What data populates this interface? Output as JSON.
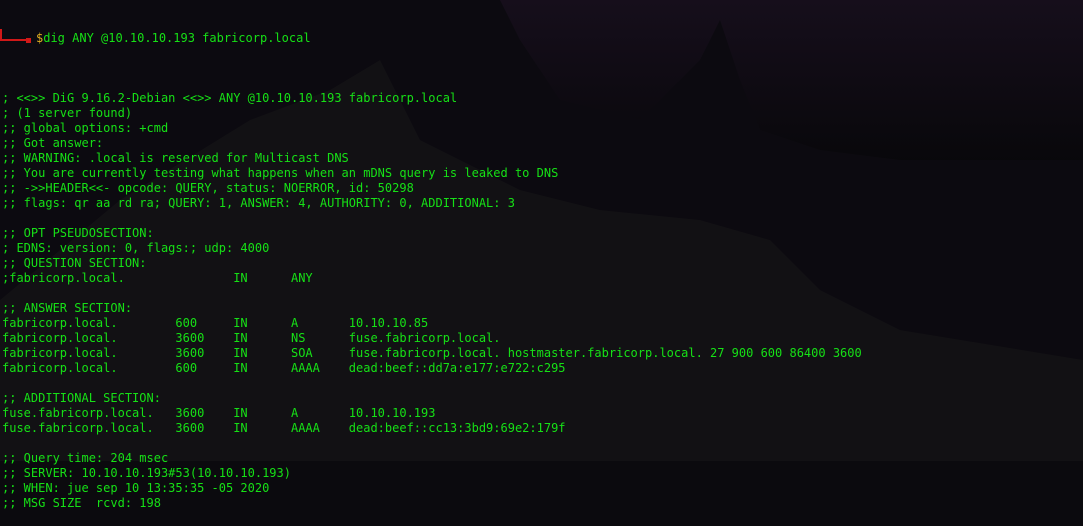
{
  "prompt": {
    "symbol": "$",
    "command": "dig ANY @10.10.10.193 fabricorp.local"
  },
  "colors": {
    "text": "#16e016",
    "prompt_symbol": "#e0b020",
    "prompt_border": "#d01818",
    "background": "#0b0a0e"
  },
  "output_lines": [
    "",
    "; <<>> DiG 9.16.2-Debian <<>> ANY @10.10.10.193 fabricorp.local",
    "; (1 server found)",
    ";; global options: +cmd",
    ";; Got answer:",
    ";; WARNING: .local is reserved for Multicast DNS",
    ";; You are currently testing what happens when an mDNS query is leaked to DNS",
    ";; ->>HEADER<<- opcode: QUERY, status: NOERROR, id: 50298",
    ";; flags: qr aa rd ra; QUERY: 1, ANSWER: 4, AUTHORITY: 0, ADDITIONAL: 3",
    "",
    ";; OPT PSEUDOSECTION:",
    "; EDNS: version: 0, flags:; udp: 4000",
    ";; QUESTION SECTION:",
    ";fabricorp.local.\t\tIN\tANY",
    "",
    ";; ANSWER SECTION:",
    "fabricorp.local.\t600\tIN\tA\t10.10.10.85",
    "fabricorp.local.\t3600\tIN\tNS\tfuse.fabricorp.local.",
    "fabricorp.local.\t3600\tIN\tSOA\tfuse.fabricorp.local. hostmaster.fabricorp.local. 27 900 600 86400 3600",
    "fabricorp.local.\t600\tIN\tAAAA\tdead:beef::dd7a:e177:e722:c295",
    "",
    ";; ADDITIONAL SECTION:",
    "fuse.fabricorp.local.\t3600\tIN\tA\t10.10.10.193",
    "fuse.fabricorp.local.\t3600\tIN\tAAAA\tdead:beef::cc13:3bd9:69e2:179f",
    "",
    ";; Query time: 204 msec",
    ";; SERVER: 10.10.10.193#53(10.10.10.193)",
    ";; WHEN: jue sep 10 13:35:35 -05 2020",
    ";; MSG SIZE  rcvd: 198"
  ]
}
